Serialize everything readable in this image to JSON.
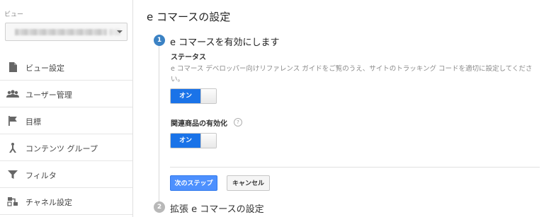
{
  "sidebar": {
    "view_label": "ビュー",
    "view_select_value": "",
    "items": [
      {
        "label": "ビュー設定",
        "icon": "document-icon"
      },
      {
        "label": "ユーザー管理",
        "icon": "users-icon"
      },
      {
        "label": "目標",
        "icon": "flag-icon"
      },
      {
        "label": "コンテンツ グループ",
        "icon": "content-group-icon"
      },
      {
        "label": "フィルタ",
        "icon": "filter-icon"
      },
      {
        "label": "チャネル設定",
        "icon": "channel-icon"
      }
    ]
  },
  "main": {
    "title": "e コマースの設定",
    "step1": {
      "number": "1",
      "title": "e コマースを有効にします",
      "status_label": "ステータス",
      "description": "e コマース デベロッパー向けリファレンス ガイドをご覧のうえ、サイトのトラッキング コードを適切に設定してください。",
      "status_toggle": "オン",
      "related_label": "関連商品の有効化",
      "help": "?",
      "related_toggle": "オン"
    },
    "buttons": {
      "next": "次のステップ",
      "cancel": "キャンセル"
    },
    "step2": {
      "number": "2",
      "title": "拡張 e コマースの設定"
    }
  },
  "colors": {
    "accent": "#1a73e8",
    "step_active": "#3b82c4",
    "step_inactive": "#b8b8b8",
    "primary_button": "#4d90fe"
  }
}
